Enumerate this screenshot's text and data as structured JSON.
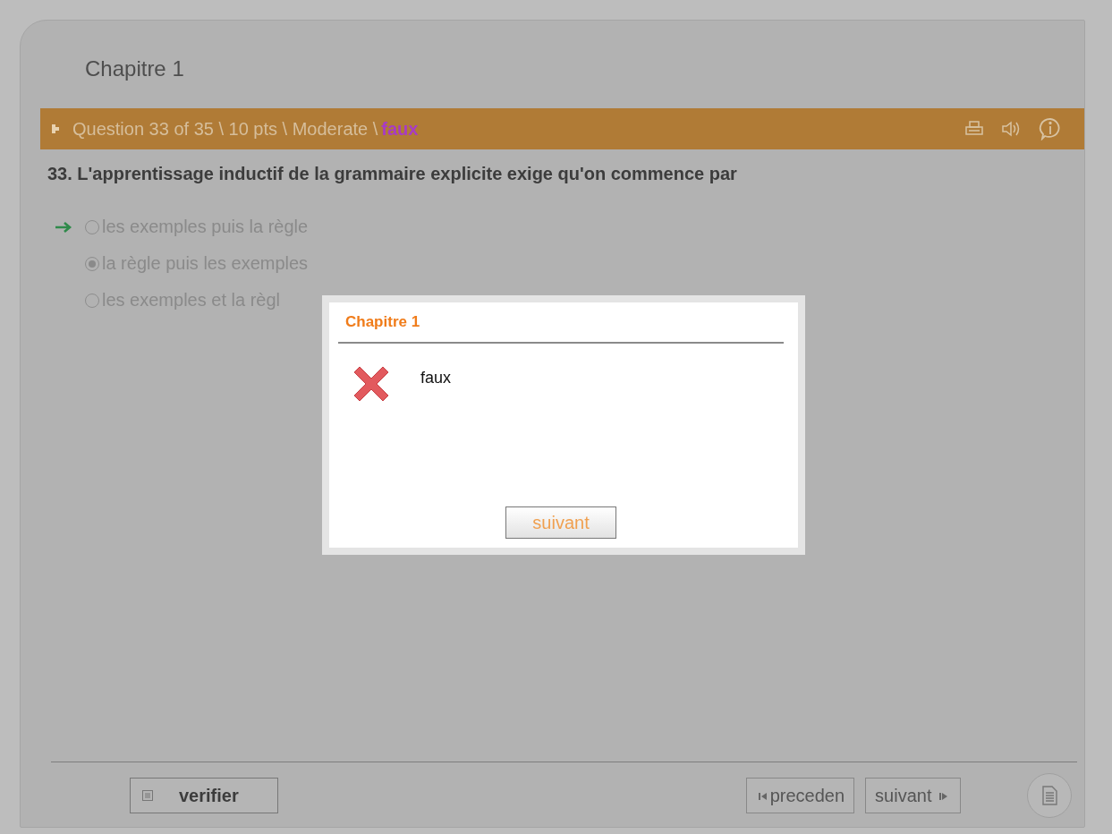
{
  "chapter_title": "Chapitre 1",
  "question_bar": {
    "info": "Question 33 of 35 \\ 10 pts \\ Moderate \\",
    "result": "faux"
  },
  "question": {
    "number": "33.",
    "text": "L'apprentissage inductif de la grammaire explicite exige qu'on commence par"
  },
  "options": [
    {
      "label": "les exemples puis la règle",
      "selected": false,
      "correct": true
    },
    {
      "label": "la règle puis les exemples",
      "selected": true,
      "correct": false
    },
    {
      "label": "les exemples et la règl",
      "selected": false,
      "correct": false
    }
  ],
  "dialog": {
    "title": "Chapitre 1",
    "message": "faux",
    "button": "suivant"
  },
  "footer": {
    "verify_button": "verifier",
    "previous_button": "preceden",
    "next_button": "suivant"
  }
}
